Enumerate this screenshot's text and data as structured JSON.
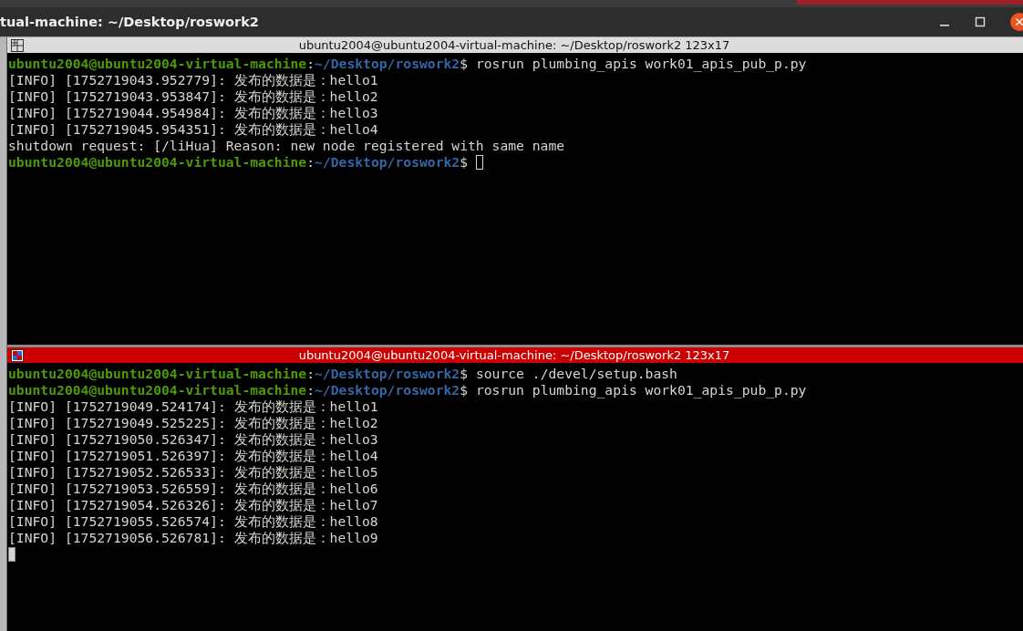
{
  "window": {
    "title": "tual-machine: ~/Desktop/roswork2"
  },
  "panes": [
    {
      "title": "ubuntu2004@ubuntu2004-virtual-machine: ~/Desktop/roswork2 123x17",
      "focused": false,
      "lines": [
        {
          "kind": "prompt",
          "user_host": "ubuntu2004@ubuntu2004-virtual-machine",
          "separator": ":",
          "path": "~/Desktop/roswork2",
          "symbol": "$",
          "command": "rosrun plumbing_apis work01_apis_pub_p.py"
        },
        {
          "kind": "output",
          "text": "[INFO] [1752719043.952779]: 发布的数据是：hello1"
        },
        {
          "kind": "output",
          "text": "[INFO] [1752719043.953847]: 发布的数据是：hello2"
        },
        {
          "kind": "output",
          "text": "[INFO] [1752719044.954984]: 发布的数据是：hello3"
        },
        {
          "kind": "output",
          "text": "[INFO] [1752719045.954351]: 发布的数据是：hello4"
        },
        {
          "kind": "output",
          "text": "shutdown request: [/liHua] Reason: new node registered with same name"
        },
        {
          "kind": "prompt",
          "user_host": "ubuntu2004@ubuntu2004-virtual-machine",
          "separator": ":",
          "path": "~/Desktop/roswork2",
          "symbol": "$",
          "cursor": true
        }
      ]
    },
    {
      "title": "ubuntu2004@ubuntu2004-virtual-machine: ~/Desktop/roswork2 123x17",
      "focused": true,
      "lines": [
        {
          "kind": "prompt",
          "user_host": "ubuntu2004@ubuntu2004-virtual-machine",
          "separator": ":",
          "path": "~/Desktop/roswork2",
          "symbol": "$",
          "command": "source ./devel/setup.bash"
        },
        {
          "kind": "prompt",
          "user_host": "ubuntu2004@ubuntu2004-virtual-machine",
          "separator": ":",
          "path": "~/Desktop/roswork2",
          "symbol": "$",
          "command": "rosrun plumbing_apis work01_apis_pub_p.py"
        },
        {
          "kind": "output",
          "text": "[INFO] [1752719049.524174]: 发布的数据是：hello1"
        },
        {
          "kind": "output",
          "text": "[INFO] [1752719049.525225]: 发布的数据是：hello2"
        },
        {
          "kind": "output",
          "text": "[INFO] [1752719050.526347]: 发布的数据是：hello3"
        },
        {
          "kind": "output",
          "text": "[INFO] [1752719051.526397]: 发布的数据是：hello4"
        },
        {
          "kind": "output",
          "text": "[INFO] [1752719052.526533]: 发布的数据是：hello5"
        },
        {
          "kind": "output",
          "text": "[INFO] [1752719053.526559]: 发布的数据是：hello6"
        },
        {
          "kind": "output",
          "text": "[INFO] [1752719054.526326]: 发布的数据是：hello7"
        },
        {
          "kind": "output",
          "text": "[INFO] [1752719055.526574]: 发布的数据是：hello8"
        },
        {
          "kind": "output",
          "text": "[INFO] [1752719056.526781]: 发布的数据是：hello9"
        },
        {
          "kind": "cursor_line",
          "cursor": true
        }
      ]
    }
  ]
}
